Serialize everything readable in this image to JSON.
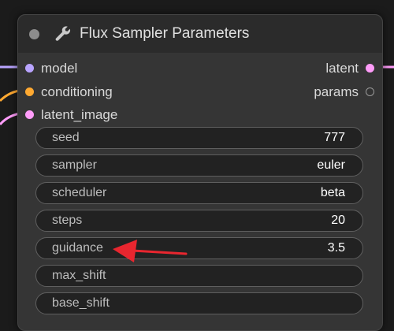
{
  "node": {
    "title": "Flux Sampler Parameters",
    "icon": "wrench-icon"
  },
  "inputs": [
    {
      "label": "model",
      "color": "#b9a4ff"
    },
    {
      "label": "conditioning",
      "color": "#ffa931"
    },
    {
      "label": "latent_image",
      "color": "#ff9cf9"
    }
  ],
  "outputs": [
    {
      "label": "latent",
      "color": "#ff9cf9"
    },
    {
      "label": "params",
      "color": "#333333"
    }
  ],
  "widgets": [
    {
      "label": "seed",
      "value": "777"
    },
    {
      "label": "sampler",
      "value": "euler"
    },
    {
      "label": "scheduler",
      "value": "beta"
    },
    {
      "label": "steps",
      "value": "20"
    },
    {
      "label": "guidance",
      "value": "3.5"
    },
    {
      "label": "max_shift",
      "value": ""
    },
    {
      "label": "base_shift",
      "value": ""
    }
  ],
  "annotation": {
    "color": "#e8262f"
  }
}
